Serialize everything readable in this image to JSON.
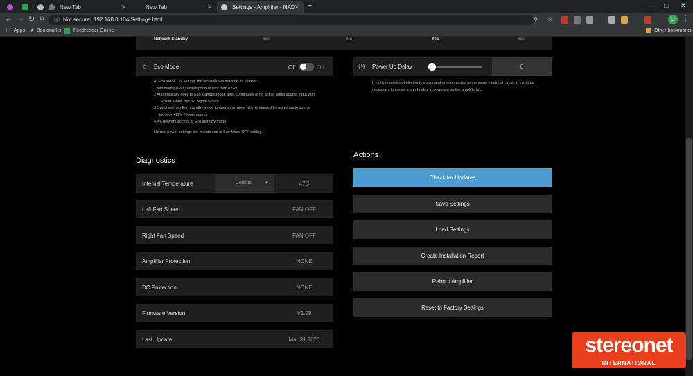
{
  "browser": {
    "tabs": [
      {
        "label": ""
      },
      {
        "label": "New Tab"
      },
      {
        "label": "New Tab"
      },
      {
        "label": "Settings - Amplifier - NAD"
      }
    ],
    "new_tab": "+",
    "secure_label": "Not secure",
    "url": "192.168.0.104/Settings.html",
    "bookmarks": [
      "Apps",
      "Bookmarks",
      "Feedreader Online"
    ],
    "other_bookmarks": "Other bookmarks",
    "profile_initial": "D"
  },
  "network_standby": {
    "label": "Network Standby",
    "values": [
      "Yes",
      "No",
      "Yes",
      "Yes"
    ]
  },
  "eco_mode": {
    "label": "Eco Mode",
    "off": "Off",
    "on": "On",
    "notes": [
      "At Eco Mode ON setting, the amplifier will function as follows:",
      "1 Minimum power consumption of less than 0.5W,",
      "2 Automatically goes to Eco standby mode after 20 minutes of no active audio source input with",
      "\"Power Mode\" set to \"Signal Sense\"",
      "3 Switches from Eco standby mode to operating mode when triggered by active audio source",
      "input or +12V Trigger source",
      "4 No network access at Eco standby mode"
    ],
    "footer": "Normal power settings are maintained at Eco Mode OFF setting."
  },
  "power_up_delay": {
    "label": "Power Up Delay",
    "value": "0",
    "level": 0,
    "note": "If multiple pieces of electronic equipment are connected to the same electrical circuit, it might be necessary to create a short delay in powering up the amplifier(s)."
  },
  "diagnostics": {
    "title": "Diagnostics",
    "temperature": {
      "label": "Internal Temperature",
      "unit": "Celsius",
      "value": "47C"
    },
    "rows": [
      {
        "label": "Left Fan Speed",
        "value": "FAN OFF"
      },
      {
        "label": "Right Fan Speed",
        "value": "FAN OFF"
      },
      {
        "label": "Amplifier Protection",
        "value": "NONE"
      },
      {
        "label": "DC Protection",
        "value": "NONE"
      },
      {
        "label": "Firmware Version",
        "value": "V1.99"
      },
      {
        "label": "Last Update",
        "value": "Mar 31 2020"
      }
    ]
  },
  "actions": {
    "title": "Actions",
    "buttons": [
      "Check for Updates",
      "Save Settings",
      "Load Settings",
      "Create Installation Report",
      "Reboot Amplifier",
      "Reset to Factory Settings"
    ]
  },
  "watermark": {
    "brand": "stereonet",
    "sub": "INTERNATIONAL"
  },
  "colors": {
    "accent": "#4a9cd3",
    "logo": "#e8401c"
  }
}
